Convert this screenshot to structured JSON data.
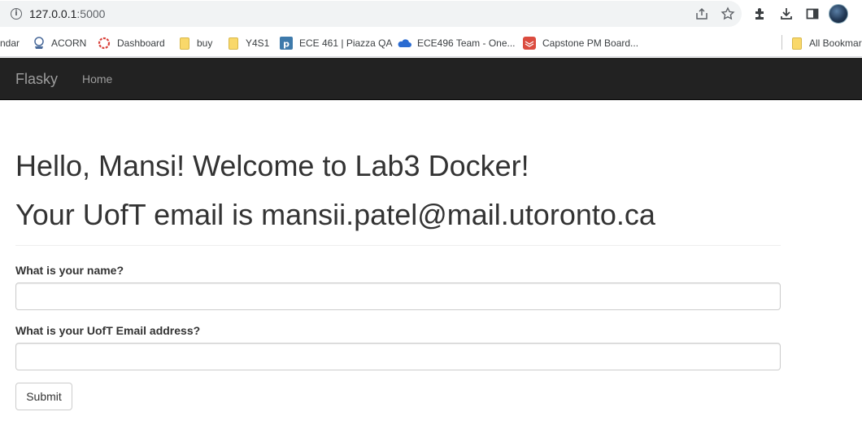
{
  "browser": {
    "url_host": "127.0.0.1",
    "url_port": ":5000"
  },
  "bookmarks": [
    {
      "label": "ndar",
      "icon": "calendar-bookmark-icon"
    },
    {
      "label": "ACORN",
      "icon": "acorn-logo-icon"
    },
    {
      "label": "Dashboard",
      "icon": "dashboard-logo-icon"
    },
    {
      "label": "buy",
      "icon": "folder-icon"
    },
    {
      "label": "Y4S1",
      "icon": "folder-icon"
    },
    {
      "label": "ECE 461 | Piazza QA",
      "icon": "piazza-logo-icon"
    },
    {
      "label": "ECE496 Team - One...",
      "icon": "onedrive-cloud-icon"
    },
    {
      "label": "Capstone PM Board...",
      "icon": "todoist-logo-icon"
    },
    {
      "label": "All Bookmar",
      "icon": "folder-icon"
    }
  ],
  "navbar": {
    "brand": "Flasky",
    "home": "Home"
  },
  "main": {
    "greeting": "Hello, Mansi! Welcome to Lab3 Docker!",
    "email_line": "Your UofT email is mansii.patel@mail.utoronto.ca",
    "form": {
      "name_label": "What is your name?",
      "name_value": "",
      "email_label": "What is your UofT Email address?",
      "email_value": "",
      "submit_label": "Submit"
    }
  },
  "colors": {
    "navbar_bg": "#222222",
    "navbar_text": "#9d9d9d",
    "heading_text": "#333333"
  }
}
